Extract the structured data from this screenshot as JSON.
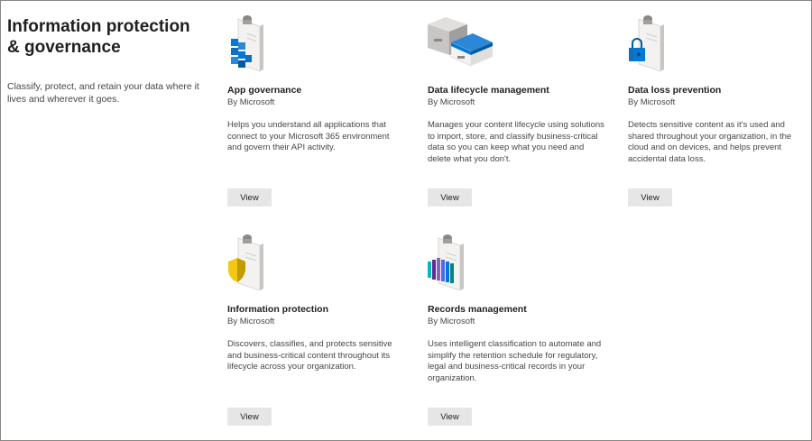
{
  "intro": {
    "title": "Information protection & governance",
    "description": "Classify, protect, and retain your data where it lives and wherever it goes."
  },
  "cards": [
    {
      "title": "App governance",
      "vendor": "By Microsoft",
      "description": "Helps you understand all applications that connect to your Microsoft 365 environment and govern their API activity.",
      "button": "View",
      "icon": "clipboard-blue-cubes-icon"
    },
    {
      "title": "Data lifecycle management",
      "vendor": "By Microsoft",
      "description": "Manages your content lifecycle using solutions to import, store, and classify business-critical data so you can keep what you need and delete what you don't.",
      "button": "View",
      "icon": "storage-boxes-icon"
    },
    {
      "title": "Data loss prevention",
      "vendor": "By Microsoft",
      "description": "Detects sensitive content as it's used and shared throughout your organization, in the cloud and on devices, and helps prevent accidental data loss.",
      "button": "View",
      "icon": "clipboard-lock-icon"
    },
    {
      "title": "Information protection",
      "vendor": "By Microsoft",
      "description": "Discovers, classifies, and protects sensitive and business-critical content throughout its lifecycle across your organization.",
      "button": "View",
      "icon": "clipboard-shield-icon"
    },
    {
      "title": "Records management",
      "vendor": "By Microsoft",
      "description": "Uses intelligent classification to automate and simplify the retention schedule for regulatory, legal and business-critical records in your organization.",
      "button": "View",
      "icon": "clipboard-binders-icon"
    }
  ]
}
